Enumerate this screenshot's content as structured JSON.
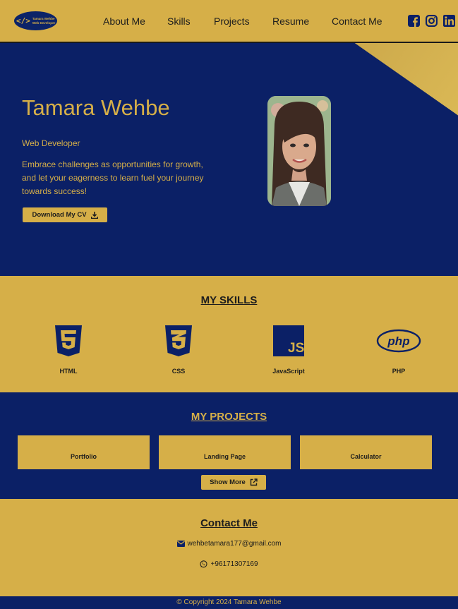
{
  "nav": {
    "logo_line1": "Tamara Wehbe",
    "logo_line2": "Web Developer",
    "logo_symbol": "</>",
    "links": [
      "About Me",
      "Skills",
      "Projects",
      "Resume",
      "Contact Me"
    ],
    "social_icons": [
      "facebook-icon",
      "instagram-icon",
      "linkedin-icon"
    ]
  },
  "hero": {
    "name": "Tamara Wehbe",
    "role": "Web Developer",
    "quote": "Embrace challenges as opportunities for growth, and let your eagerness to learn fuel your journey towards success!",
    "cv_button": "Download My CV"
  },
  "skills": {
    "title": "MY SKILLS",
    "items": [
      {
        "label": "HTML",
        "icon": "html5-icon"
      },
      {
        "label": "CSS",
        "icon": "css3-icon"
      },
      {
        "label": "JavaScript",
        "icon": "javascript-icon"
      },
      {
        "label": "PHP",
        "icon": "php-icon"
      }
    ]
  },
  "projects": {
    "title": "MY PROJECTS",
    "items": [
      "Portfolio",
      "Landing Page",
      "Calculator"
    ],
    "more_button": "Show More"
  },
  "contact": {
    "title": "Contact Me",
    "email": "wehbetamara177@gmail.com",
    "phone": "+96171307169"
  },
  "footer": {
    "copyright": "© Copyright 2024 Tamara Wehbe"
  },
  "colors": {
    "gold": "#d6af48",
    "navy": "#0b2066",
    "text_dark": "#1d1d1d"
  }
}
